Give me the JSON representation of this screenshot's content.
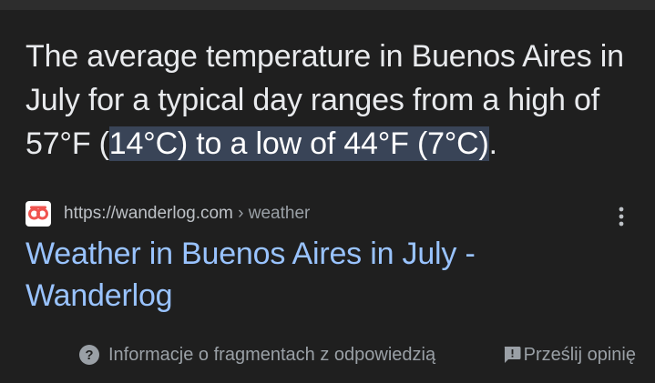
{
  "snippet": {
    "text_before": "The average temperature in Buenos Aires in July for a typical day ranges from a high of 57°F (",
    "text_highlight": "14°C) to a low of 44°F (7°C)",
    "text_after": "."
  },
  "result": {
    "url": "https://wanderlog.com",
    "breadcrumb": " › weather",
    "title": "Weather in Buenos Aires in July - Wanderlog",
    "favicon_icon": "wanderlog-logo-icon",
    "favicon_color": "#f0544f"
  },
  "footer": {
    "about_label": "Informacje o fragmentach z odpowiedzią",
    "feedback_label": "Prześlij opinię"
  },
  "colors": {
    "background": "#1f1f1f",
    "text": "#e8eaed",
    "link": "#99c3ff",
    "highlight": "#394457",
    "muted": "#9aa0a6"
  }
}
